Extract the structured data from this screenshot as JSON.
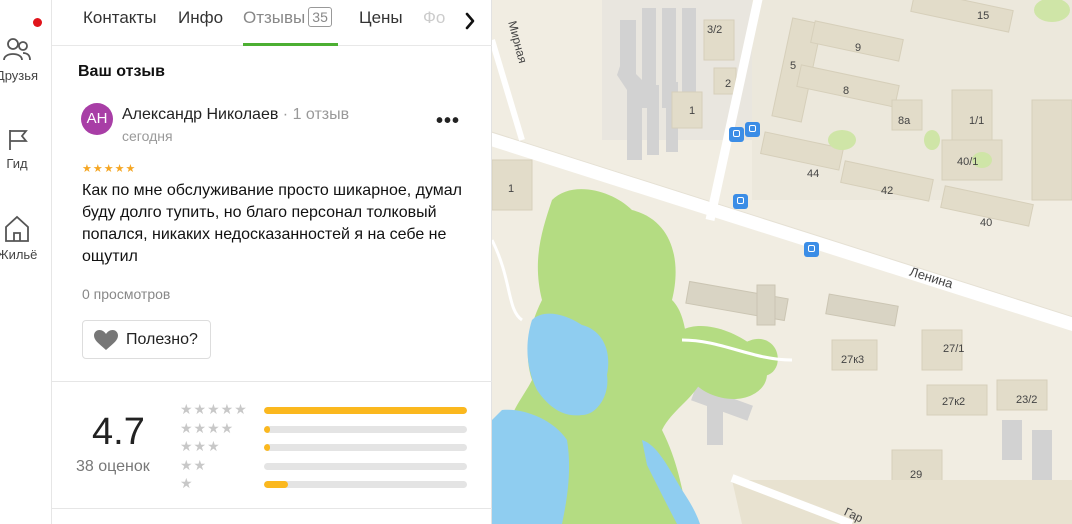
{
  "rail": {
    "items": [
      {
        "label": "Друзья"
      },
      {
        "label": "Гид"
      },
      {
        "label": "Жильё"
      }
    ]
  },
  "tabs": [
    {
      "label": "Контакты"
    },
    {
      "label": "Инфо"
    },
    {
      "label": "Отзывы",
      "count": "35"
    },
    {
      "label": "Цены"
    },
    {
      "label": "Фо"
    }
  ],
  "review_section": {
    "title": "Ваш отзыв",
    "review": {
      "avatar_initials": "АН",
      "author": "Александр Николаев",
      "author_meta": " · 1 отзыв",
      "date": "сегодня",
      "stars": "★★★★★",
      "text": "Как по мне обслуживание просто шикарное, думал буду долго тупить, но благо персонал толковый попался, никаких недосказанностей я на себе не ощутил",
      "views": "0 просмотров",
      "useful_label": "Полезно?",
      "more_label": "•••"
    }
  },
  "rating": {
    "score": "4.7",
    "count_label": "38 оценок",
    "distribution": [
      {
        "stars": "★★★★★",
        "fraction": 1.0
      },
      {
        "stars": "★★★★",
        "fraction": 0.03
      },
      {
        "stars": "★★★",
        "fraction": 0.03
      },
      {
        "stars": "★★",
        "fraction": 0.0
      },
      {
        "stars": "★",
        "fraction": 0.12
      }
    ]
  },
  "map": {
    "labels": [
      {
        "text": "3/2"
      },
      {
        "text": "15"
      },
      {
        "text": "9"
      },
      {
        "text": "5"
      },
      {
        "text": "8"
      },
      {
        "text": "2"
      },
      {
        "text": "1"
      },
      {
        "text": "8а"
      },
      {
        "text": "1/1"
      },
      {
        "text": "40/1"
      },
      {
        "text": "44"
      },
      {
        "text": "42"
      },
      {
        "text": "40"
      },
      {
        "text": "1"
      },
      {
        "text": "Ленина"
      },
      {
        "text": "Мирная"
      },
      {
        "text": "27к3"
      },
      {
        "text": "27/1"
      },
      {
        "text": "27к2"
      },
      {
        "text": "23/2"
      },
      {
        "text": "29"
      },
      {
        "text": "Гар"
      }
    ]
  },
  "colors": {
    "accent_green": "#4caf32",
    "star_yellow": "#fbb81e",
    "avatar_purple": "#a83ea6",
    "water": "#8fcdf0",
    "park": "#b4dc82"
  }
}
